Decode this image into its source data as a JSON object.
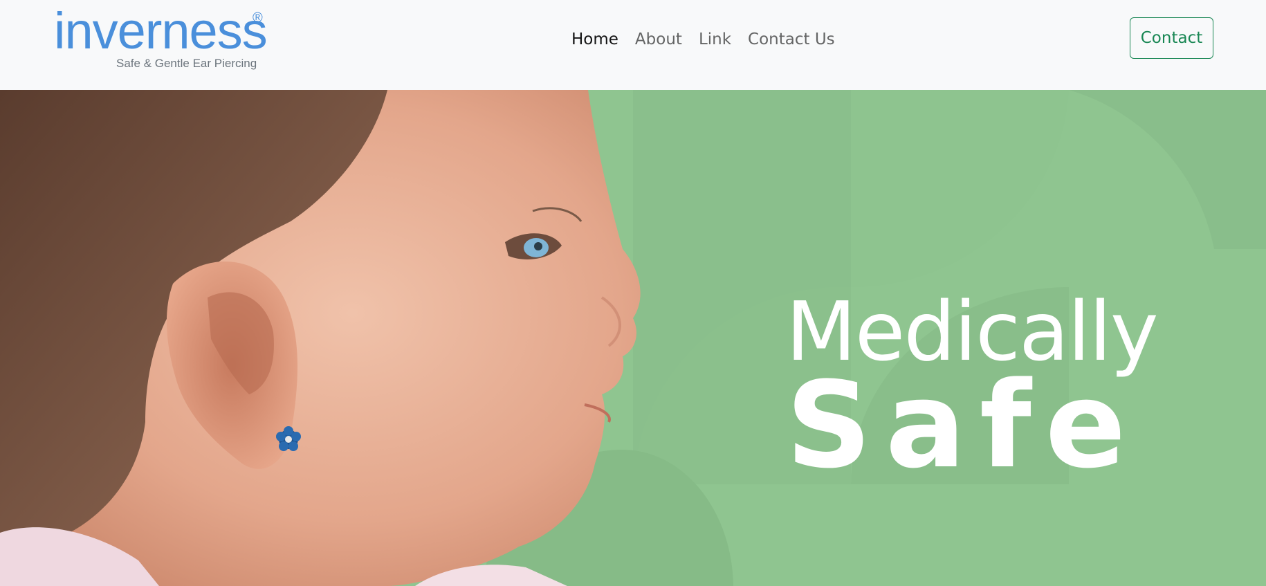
{
  "brand": {
    "name": "inverness",
    "registered": "®",
    "tagline": "Safe & Gentle Ear Piercing",
    "color": "#4a8fdb"
  },
  "nav": {
    "items": [
      {
        "label": "Home",
        "active": true
      },
      {
        "label": "About",
        "active": false
      },
      {
        "label": "Link",
        "active": false
      },
      {
        "label": "Contact Us",
        "active": false
      }
    ],
    "cta_label": "Contact",
    "cta_color": "#198754"
  },
  "hero": {
    "headline_line1": "Medically",
    "headline_line2": "Safe",
    "background_color": "#8fc590",
    "image": "baby-profile-with-flower-earring"
  }
}
